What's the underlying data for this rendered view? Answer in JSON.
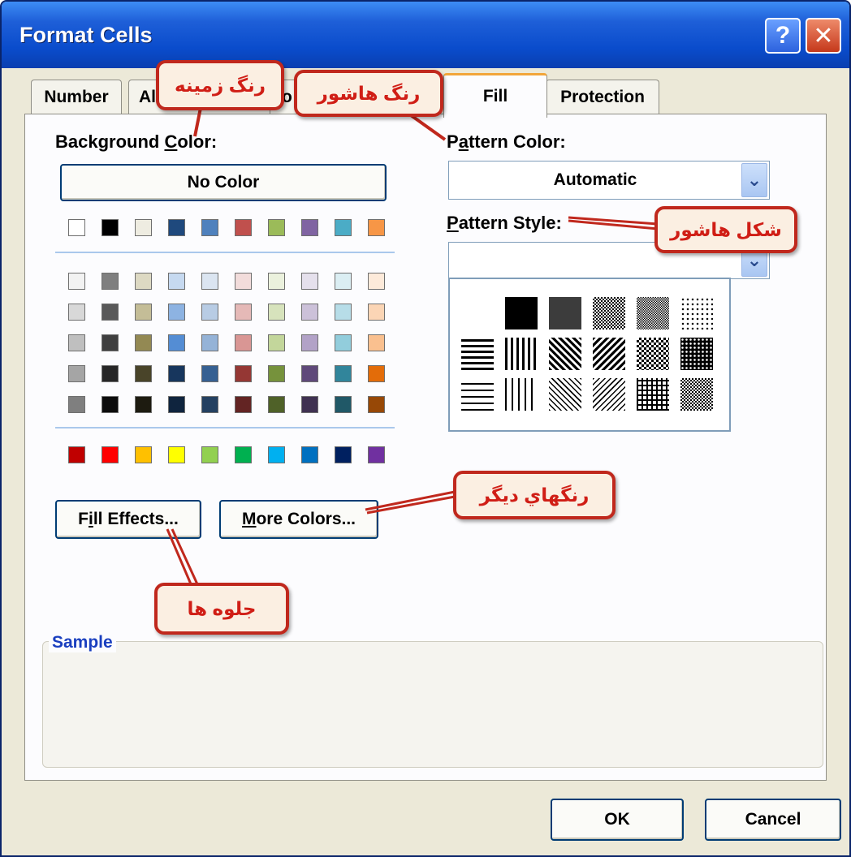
{
  "window": {
    "title": "Format Cells",
    "help_glyph": "?",
    "close_glyph": "✕"
  },
  "tabs": [
    {
      "label": "Number"
    },
    {
      "label": "Al"
    },
    {
      "label": "o"
    },
    {
      "label": "Fill",
      "active": true
    },
    {
      "label": "Protection"
    }
  ],
  "background_color": {
    "label_pre": "Background ",
    "label_hot": "C",
    "label_post": "olor:",
    "no_color_button": "No Color",
    "theme_top_row": [
      "#ffffff",
      "#000000",
      "#eeece1",
      "#1f497d",
      "#4f81bd",
      "#c0504d",
      "#9bbb59",
      "#8064a2",
      "#4bacc6",
      "#f79646"
    ],
    "theme_shades": [
      [
        "#f2f2f2",
        "#7f7f7f",
        "#ddd9c3",
        "#c6d9f0",
        "#dbe5f1",
        "#f2dcdb",
        "#ebf1dd",
        "#e5e0ec",
        "#dbeef3",
        "#fdeada"
      ],
      [
        "#d8d8d8",
        "#595959",
        "#c4bd97",
        "#8db3e2",
        "#b8cce4",
        "#e5b9b7",
        "#d7e3bc",
        "#ccc1d9",
        "#b7dde8",
        "#fbd5b5"
      ],
      [
        "#bfbfbf",
        "#3f3f3f",
        "#938953",
        "#548dd4",
        "#95b3d7",
        "#d99694",
        "#c3d69b",
        "#b2a2c7",
        "#92cddc",
        "#fac08f"
      ],
      [
        "#a5a5a5",
        "#262626",
        "#494429",
        "#17365d",
        "#366092",
        "#953734",
        "#76923c",
        "#5f497a",
        "#31859b",
        "#e36c09"
      ],
      [
        "#7f7f7f",
        "#0c0c0c",
        "#1d1b10",
        "#0f243e",
        "#244061",
        "#632423",
        "#4f6128",
        "#3f3151",
        "#205867",
        "#974806"
      ]
    ],
    "standard_colors": [
      "#c00000",
      "#ff0000",
      "#ffc000",
      "#ffff00",
      "#92d050",
      "#00b050",
      "#00b0f0",
      "#0070c0",
      "#002060",
      "#7030a0"
    ]
  },
  "pattern_color": {
    "label_pre": "P",
    "label_hot": "a",
    "label_post": "ttern Color:",
    "value": "Automatic",
    "arrow_glyph": "⌄"
  },
  "pattern_style": {
    "label_hot": "P",
    "label_post": "attern Style:",
    "arrow_glyph": "⌄"
  },
  "buttons": {
    "fill_effects_pre": "F",
    "fill_effects_hot": "i",
    "fill_effects_post": "ll Effects...",
    "more_colors_hot": "M",
    "more_colors_post": "ore Colors...",
    "ok": "OK",
    "cancel": "Cancel"
  },
  "sample": {
    "legend": "Sample"
  },
  "annotations": {
    "background_color": "رنگ زمینه",
    "pattern_color": "رنگ هاشور",
    "pattern_style": "شکل هاشور",
    "more_colors": "رنگهاي ديگر",
    "fill_effects": "جلوه ها"
  },
  "colors": {
    "title_bar": "#0a4ccc",
    "dialog_bg": "#ece9d8",
    "callout_border": "#c0281d",
    "callout_text": "#d01e16",
    "active_tab_accent": "#f2a63a"
  }
}
